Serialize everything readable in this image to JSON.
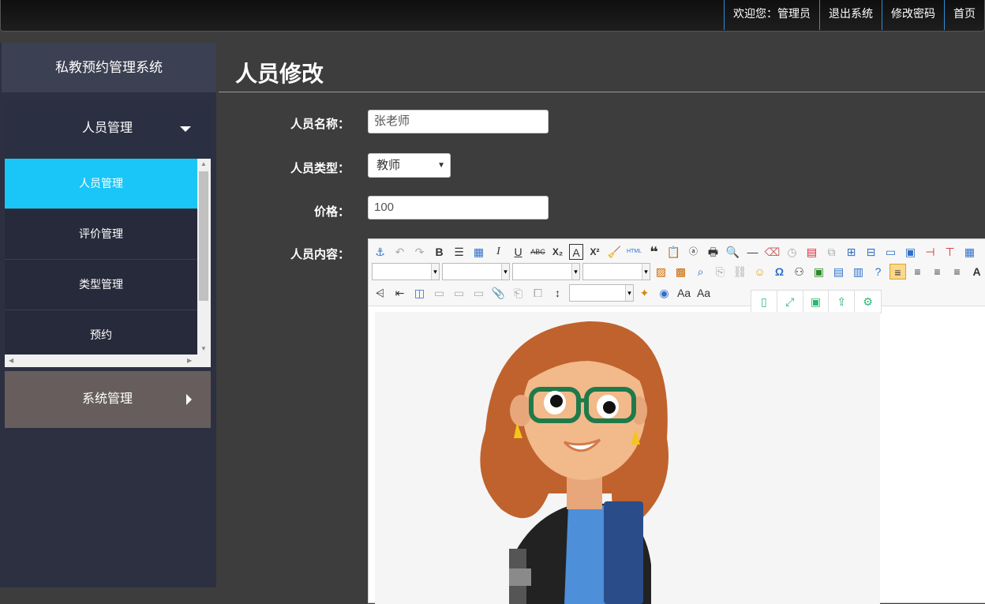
{
  "header": {
    "nav": [
      {
        "label": "欢迎您：管理员"
      },
      {
        "label": "退出系统"
      },
      {
        "label": "修改密码"
      },
      {
        "label": "首页"
      }
    ]
  },
  "sidebar": {
    "brand": "私教预约管理系统",
    "groups": [
      {
        "label": "人员管理",
        "expanded": true
      },
      {
        "label": "系统管理",
        "expanded": false
      }
    ],
    "items": [
      {
        "label": "人员管理",
        "active": true
      },
      {
        "label": "评价管理"
      },
      {
        "label": "类型管理"
      },
      {
        "label": "预约"
      }
    ]
  },
  "main": {
    "title": "人员修改",
    "form": {
      "name_label": "人员名称：",
      "name_value": "张老师",
      "type_label": "人员类型：",
      "type_value": "教师",
      "price_label": "价格：",
      "price_value": "100",
      "content_label": "人员内容："
    }
  },
  "colors": {
    "accent": "#1ac6f7",
    "sidebar_bg": "#2d3040",
    "main_bg": "#3d3d3d",
    "system_group_bg": "#675d5d",
    "float_icon": "#2bb673"
  }
}
